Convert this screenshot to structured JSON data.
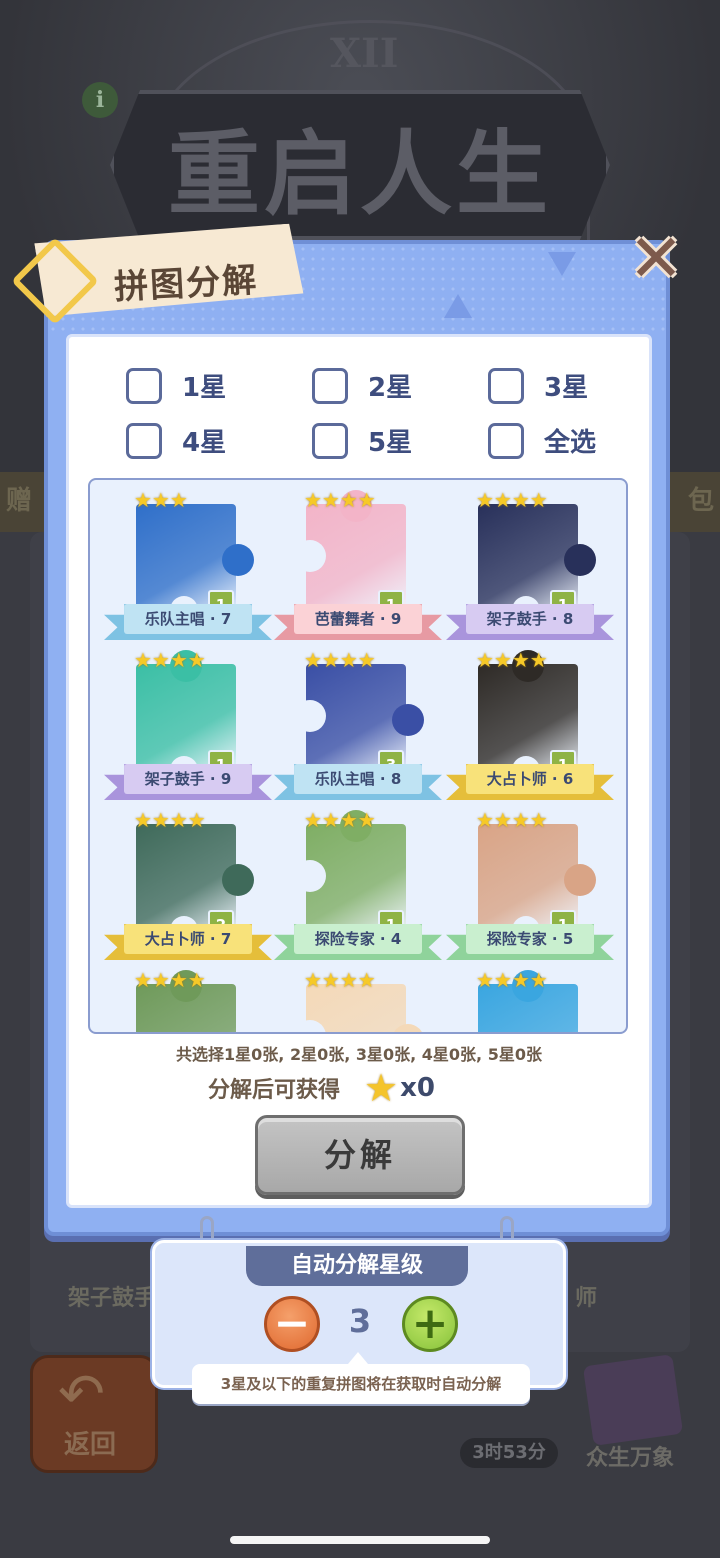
{
  "background": {
    "title": "重启人生",
    "numeral": "XII",
    "info_icon": "i",
    "strip_left": "赠",
    "strip_right": "包",
    "card_left": "架子鼓手",
    "card_right": "师",
    "back_label": "返回",
    "timer": "3时53分",
    "book_label": "众生万象"
  },
  "dialog": {
    "title": "拼图分解",
    "close_icon": "close-icon"
  },
  "filters": [
    {
      "label": "1星"
    },
    {
      "label": "2星"
    },
    {
      "label": "3星"
    },
    {
      "label": "4星"
    },
    {
      "label": "5星"
    },
    {
      "label": "全选"
    }
  ],
  "pieces": [
    {
      "name": "乐队主唱 · 7",
      "count": "1",
      "stars": "★★★",
      "color": "#2f6fc9",
      "ribbon": "#bfe3f3",
      "ribbon_edge": "#7ec2e3"
    },
    {
      "name": "芭蕾舞者 · 9",
      "count": "1",
      "stars": "★★★★",
      "color": "#f3b4c8",
      "ribbon": "#fbd2d6",
      "ribbon_edge": "#e79aa3"
    },
    {
      "name": "架子鼓手 · 8",
      "count": "1",
      "stars": "★★★★",
      "color": "#28305a",
      "ribbon": "#d7cbf2",
      "ribbon_edge": "#a994dc"
    },
    {
      "name": "架子鼓手 · 9",
      "count": "1",
      "stars": "★★★★",
      "color": "#3bbfa5",
      "ribbon": "#d7cbf2",
      "ribbon_edge": "#a994dc"
    },
    {
      "name": "乐队主唱 · 8",
      "count": "3",
      "stars": "★★★★",
      "color": "#3a4fa5",
      "ribbon": "#bfe3f3",
      "ribbon_edge": "#7ec2e3"
    },
    {
      "name": "大占卜师 · 6",
      "count": "1",
      "stars": "★★★★",
      "color": "#2e2a26",
      "ribbon": "#f8e27a",
      "ribbon_edge": "#e5be3a"
    },
    {
      "name": "大占卜师 · 7",
      "count": "2",
      "stars": "★★★★",
      "color": "#3f6a5a",
      "ribbon": "#f8e27a",
      "ribbon_edge": "#e5be3a"
    },
    {
      "name": "探险专家 · 4",
      "count": "1",
      "stars": "★★★★",
      "color": "#7fae64",
      "ribbon": "#c9efcf",
      "ribbon_edge": "#8fd39b"
    },
    {
      "name": "探险专家 · 5",
      "count": "1",
      "stars": "★★★★",
      "color": "#d9a486",
      "ribbon": "#c9efcf",
      "ribbon_edge": "#8fd39b"
    },
    {
      "name": "",
      "count": "",
      "stars": "★★★★",
      "color": "#6f9a5a",
      "ribbon": "",
      "ribbon_edge": ""
    },
    {
      "name": "",
      "count": "",
      "stars": "★★★★",
      "color": "#f4d9b8",
      "ribbon": "",
      "ribbon_edge": ""
    },
    {
      "name": "",
      "count": "",
      "stars": "★★★★",
      "color": "#3aa6e0",
      "ribbon": "",
      "ribbon_edge": ""
    }
  ],
  "summary": "共选择1星0张, 2星0张, 3星0张, 4星0张, 5星0张",
  "yield": {
    "label": "分解后可获得",
    "icon": "star-icon",
    "count": "x0"
  },
  "decompose_button": "分解",
  "auto": {
    "title": "自动分解星级",
    "minus": "−",
    "plus": "+",
    "level": "3",
    "tooltip": "3星及以下的重复拼图将在获取时自动分解"
  }
}
